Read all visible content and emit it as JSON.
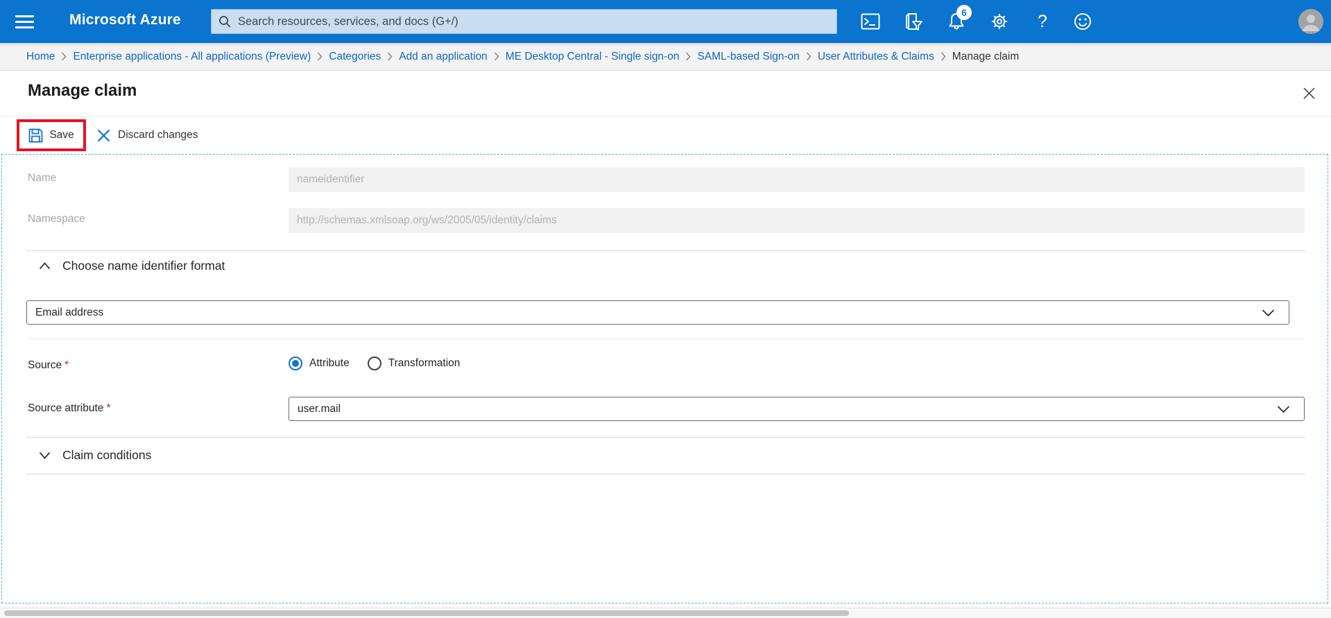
{
  "colors": {
    "header_blue": "#0b74ce",
    "accent_blue": "#1273ca",
    "link_blue": "#1166bc",
    "annotation_red": "#e81123",
    "dashed_teal": "#45b6d3"
  },
  "header": {
    "brand": "Microsoft Azure",
    "search": {
      "placeholder": "Search resources, services, and docs (G+/)"
    },
    "notifications_badge": "6",
    "help_glyph": "?"
  },
  "breadcrumb": {
    "items": [
      {
        "label": "Home"
      },
      {
        "label": "Enterprise applications - All applications (Preview)"
      },
      {
        "label": "Categories"
      },
      {
        "label": "Add an application"
      },
      {
        "label": "ME Desktop Central - Single sign-on"
      },
      {
        "label": "SAML-based Sign-on"
      },
      {
        "label": "User Attributes & Claims"
      },
      {
        "label": "Manage claim"
      }
    ]
  },
  "panel": {
    "title": "Manage claim"
  },
  "toolbar": {
    "save_label": "Save",
    "discard_label": "Discard changes"
  },
  "form": {
    "name": {
      "label": "Name",
      "value": "nameidentifier"
    },
    "namespace": {
      "label": "Namespace",
      "value": "http://schemas.xmlsoap.org/ws/2005/05/identity/claims"
    },
    "identifier_format": {
      "section_title": "Choose name identifier format",
      "selected": "Email address"
    },
    "source": {
      "label": "Source",
      "required_marker": "*",
      "options": [
        {
          "label": "Attribute",
          "selected": true
        },
        {
          "label": "Transformation",
          "selected": false
        }
      ]
    },
    "source_attribute": {
      "label": "Source attribute",
      "required_marker": "*",
      "value": "user.mail"
    },
    "claim_conditions": {
      "section_title": "Claim conditions"
    }
  }
}
